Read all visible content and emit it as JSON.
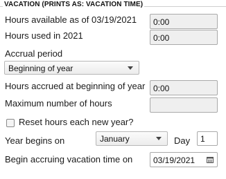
{
  "section_title": "VACATION (PRINTS AS: VACATION TIME)",
  "hours_available": {
    "label": "Hours available as of 03/19/2021",
    "value": "0:00"
  },
  "hours_used": {
    "label": "Hours used in 2021",
    "value": "0:00"
  },
  "accrual_period": {
    "label": "Accrual period",
    "selected": "Beginning of year"
  },
  "hours_accrued": {
    "label": "Hours accrued at beginning of year",
    "value": "0:00"
  },
  "max_hours": {
    "label": "Maximum number of hours",
    "value": ""
  },
  "reset_hours": {
    "label": "Reset hours each new year?",
    "checked": false
  },
  "year_begins": {
    "label": "Year begins on",
    "month": "January",
    "day_label": "Day",
    "day": "1"
  },
  "begin_accruing": {
    "label": "Begin accruing vacation time on",
    "date": "03/19/2021",
    "icon": "calendar-icon"
  },
  "colors": {
    "field_bg": "#efefef",
    "border": "#a9a9a9"
  }
}
